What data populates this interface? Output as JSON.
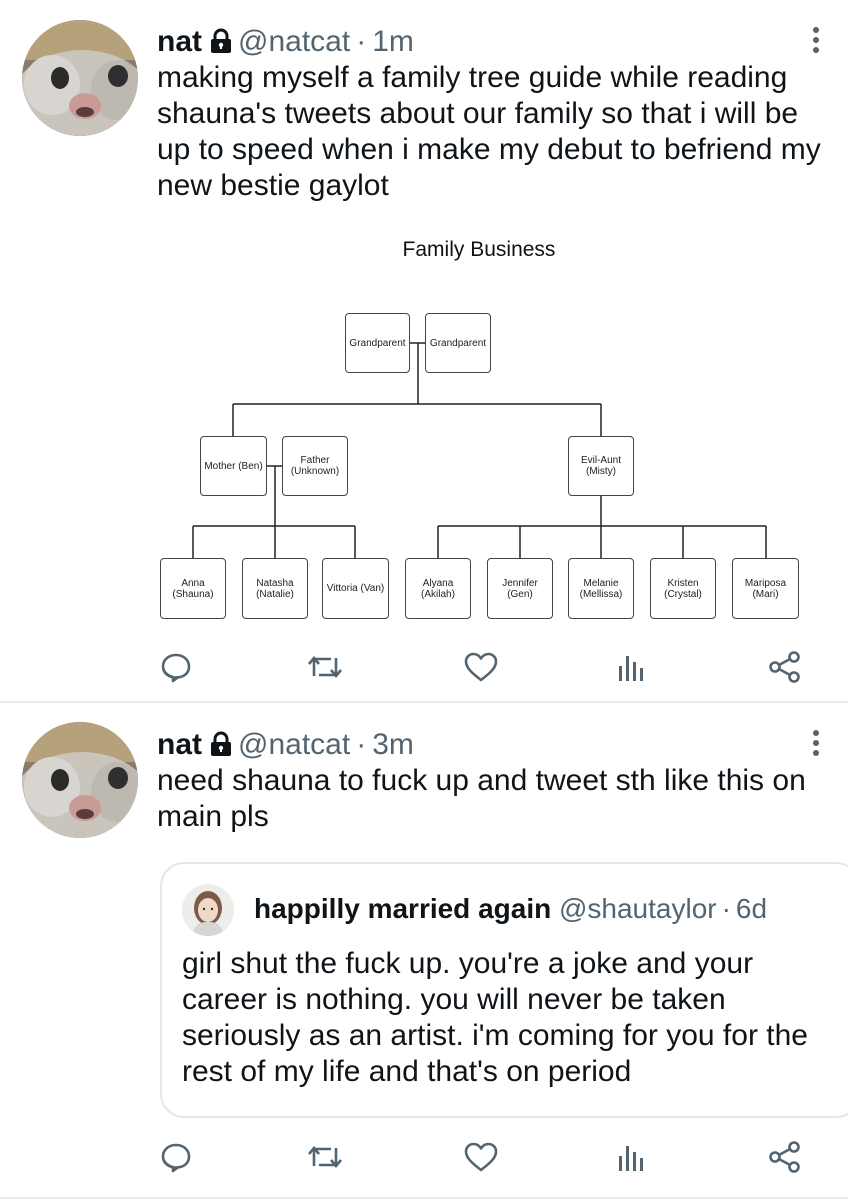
{
  "tweets": [
    {
      "name": "nat",
      "handle": "@natcat",
      "time": "1m",
      "text": "making myself a family tree guide while reading shauna's tweets about our family so that i will be up to speed when i make my debut to befriend my new bestie gaylot",
      "media": {
        "title": "Family Business",
        "nodes": {
          "gp1": "Grandparent",
          "gp2": "Grandparent",
          "mother": "Mother (Ben)",
          "father": "Father\n(Unknown)",
          "aunt": "Evil-Aunt\n(Misty)",
          "c1": "Anna\n(Shauna)",
          "c2": "Natasha\n(Natalie)",
          "c3": "Vittoria (Van)",
          "c4": "Alyana\n(Akilah)",
          "c5": "Jennifer\n(Gen)",
          "c6": "Melanie\n(Mellissa)",
          "c7": "Kristen\n(Crystal)",
          "c8": "Mariposa\n(Mari)"
        }
      }
    },
    {
      "name": "nat",
      "handle": "@natcat",
      "time": "3m",
      "text": "need shauna to fuck up and tweet sth like this on main pls",
      "quote": {
        "name": "happilly married again",
        "handle": "@shautaylor",
        "time": "6d",
        "text": "girl shut the fuck up. you're a joke and your career is nothing. you will never be taken seriously as an artist. i'm coming for you for the rest of my life and that's on period"
      }
    }
  ],
  "separator": "·",
  "colors": {
    "text": "#0f1419",
    "secondary": "#536471",
    "divider": "#e6ecf0"
  },
  "icons": [
    "lock-icon",
    "more-icon",
    "reply-icon",
    "retweet-icon",
    "like-icon",
    "analytics-icon",
    "share-icon"
  ]
}
